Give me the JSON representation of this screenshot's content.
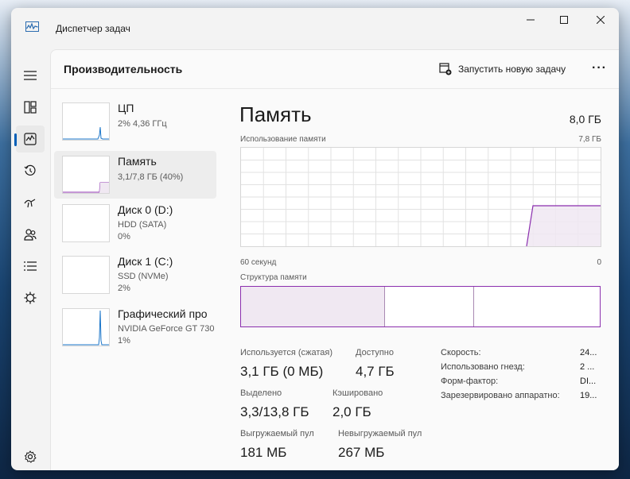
{
  "app": {
    "title": "Диспетчер задач"
  },
  "header": {
    "title": "Производительность",
    "new_task": "Запустить новую задачу",
    "more": "···"
  },
  "nav": {
    "items": [
      {
        "icon": "hamburger-menu-icon"
      },
      {
        "icon": "processes-icon"
      },
      {
        "icon": "performance-icon",
        "active": true
      },
      {
        "icon": "app-history-icon"
      },
      {
        "icon": "startup-apps-icon"
      },
      {
        "icon": "users-icon"
      },
      {
        "icon": "details-icon"
      },
      {
        "icon": "services-icon"
      },
      {
        "icon": "settings-icon"
      }
    ]
  },
  "sidebar": {
    "items": [
      {
        "name": "ЦП",
        "sub1": "2% 4,36 ГГц",
        "sub2": ""
      },
      {
        "name": "Память",
        "sub1": "3,1/7,8 ГБ (40%)",
        "sub2": ""
      },
      {
        "name": "Диск 0 (D:)",
        "sub1": "HDD (SATA)",
        "sub2": "0%"
      },
      {
        "name": "Диск 1 (C:)",
        "sub1": "SSD (NVMe)",
        "sub2": "2%"
      },
      {
        "name": "Графический про",
        "sub1": "NVIDIA GeForce GT 730",
        "sub2": "1%"
      }
    ]
  },
  "memory": {
    "title": "Память",
    "total": "8,0 ГБ",
    "usage_label": "Использование памяти",
    "usage_max": "7,8 ГБ",
    "time_left": "60 секунд",
    "time_right": "0",
    "structure_label": "Структура памяти",
    "stats": {
      "in_use_label": "Используется (сжатая)",
      "in_use": "3,1 ГБ (0 МБ)",
      "available_label": "Доступно",
      "available": "4,7 ГБ",
      "committed_label": "Выделено",
      "committed": "3,3/13,8 ГБ",
      "cached_label": "Кэшировано",
      "cached": "2,0 ГБ",
      "paged_label": "Выгружаемый пул",
      "paged": "181 МБ",
      "nonpaged_label": "Невыгружаемый пул",
      "nonpaged": "267 МБ"
    },
    "details": [
      {
        "label": "Скорость:",
        "value": "24..."
      },
      {
        "label": "Использовано гнезд:",
        "value": "2 ..."
      },
      {
        "label": "Форм-фактор:",
        "value": "DI..."
      },
      {
        "label": "Зарезервировано аппаратно:",
        "value": "19..."
      }
    ]
  },
  "colors": {
    "accent": "#8b2fae",
    "fill": "#f0e8f2",
    "grid": "#e2e2e2"
  }
}
